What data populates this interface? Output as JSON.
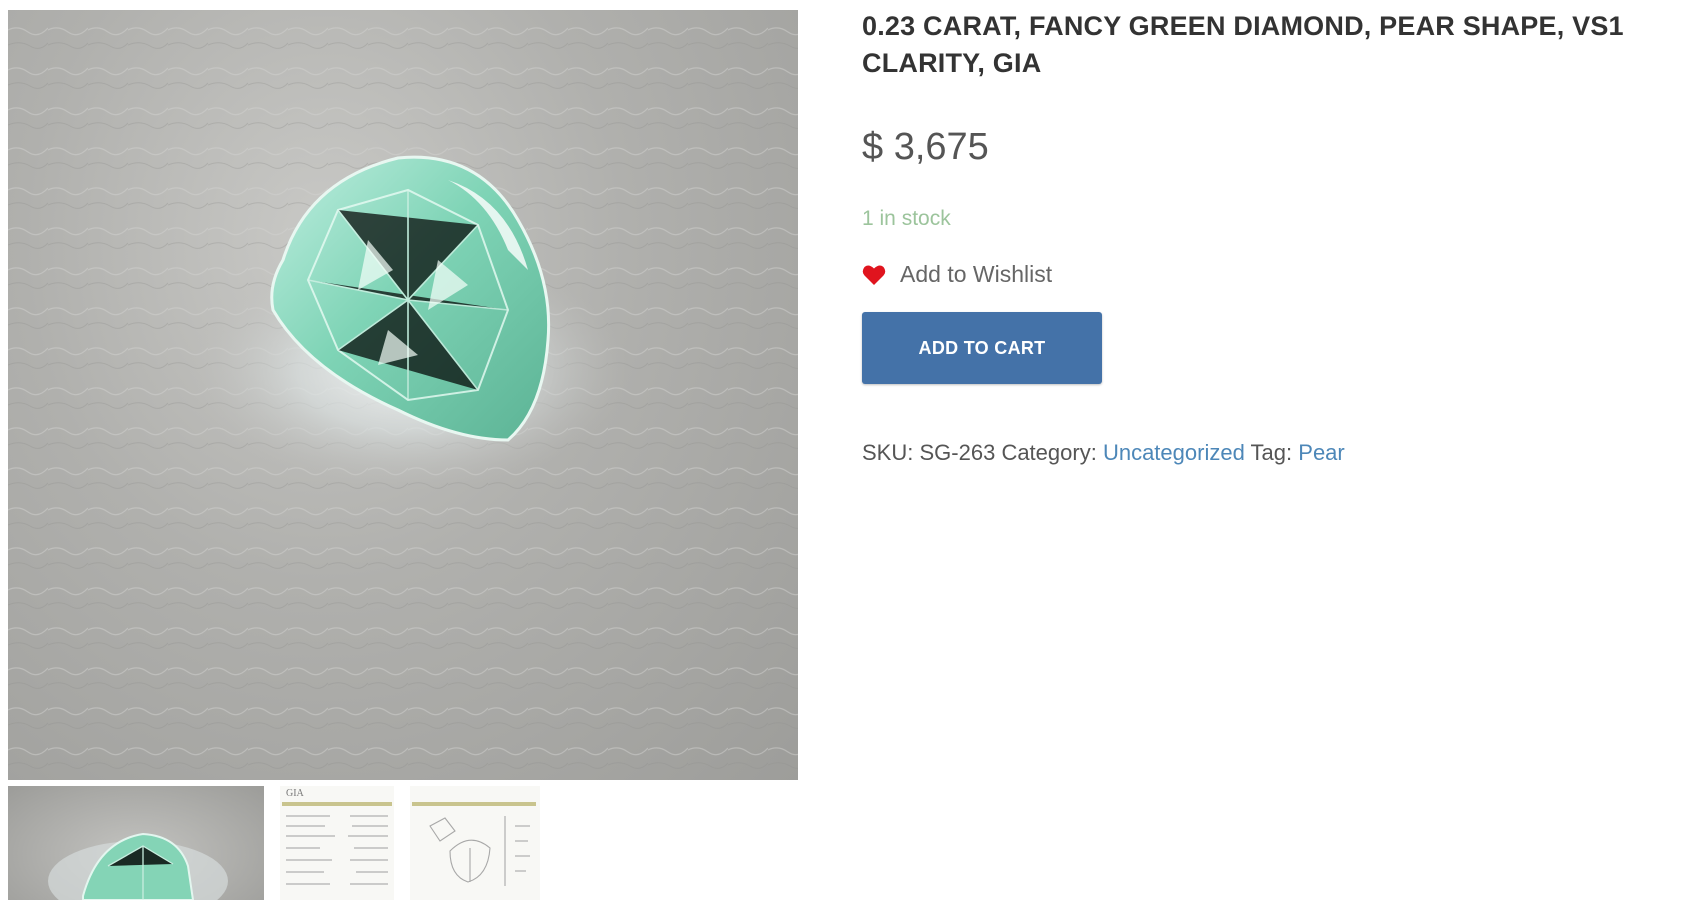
{
  "product": {
    "title": "0.23 CARAT, FANCY GREEN DIAMOND, PEAR SHAPE, VS1 CLARITY, GIA",
    "price": "$ 3,675",
    "stock": "1 in stock",
    "wishlist_label": "Add to Wishlist",
    "add_to_cart_label": "ADD TO CART"
  },
  "meta": {
    "sku_label": "SKU:",
    "sku_value": "SG-263",
    "category_label": "Category:",
    "category_value": "Uncategorized",
    "tag_label": "Tag:",
    "tag_value": "Pear"
  },
  "gallery": {
    "main_image": "green-pear-diamond-photo",
    "thumbnails": [
      "green-pear-diamond-photo",
      "gia-certificate-page-1",
      "gia-certificate-page-2"
    ]
  },
  "colors": {
    "button": "#4472a8",
    "link": "#4d87b8",
    "stock": "#9cc49c",
    "heart": "#e0141e",
    "title": "#333333"
  },
  "icons": {
    "wishlist": "heart-icon"
  }
}
